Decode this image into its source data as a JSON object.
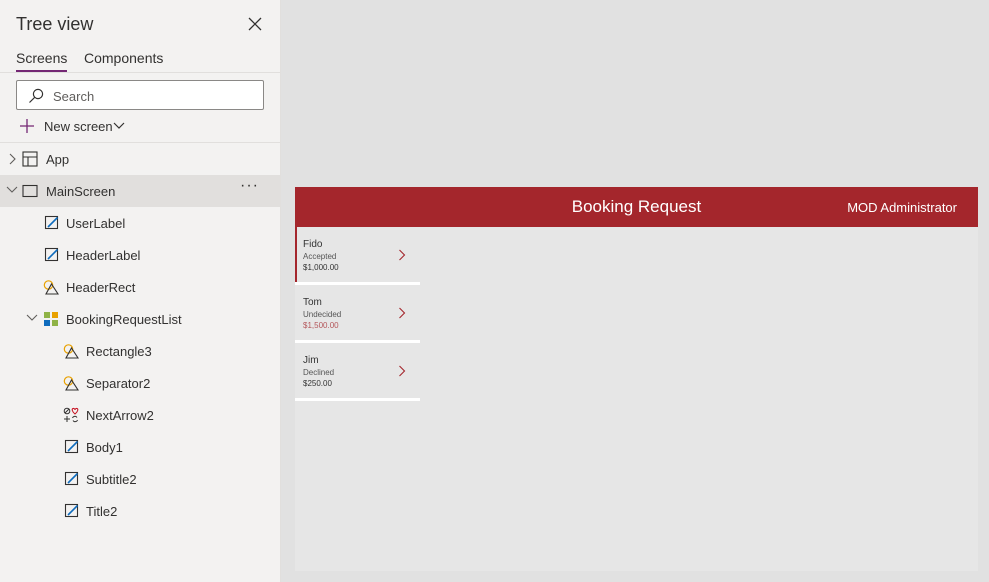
{
  "tree_panel": {
    "title": "Tree view",
    "tabs": [
      {
        "label": "Screens",
        "active": true
      },
      {
        "label": "Components",
        "active": false
      }
    ],
    "search": {
      "placeholder": "Search",
      "value": ""
    },
    "new_screen_label": "New screen",
    "items": [
      {
        "label": "App",
        "icon": "app-icon",
        "level": 0,
        "expander": "collapsed"
      },
      {
        "label": "MainScreen",
        "icon": "screen-icon",
        "level": 0,
        "expander": "expanded",
        "selected": true
      },
      {
        "label": "UserLabel",
        "icon": "label-icon",
        "level": 1
      },
      {
        "label": "HeaderLabel",
        "icon": "label-icon",
        "level": 1
      },
      {
        "label": "HeaderRect",
        "icon": "shape-icon",
        "level": 1
      },
      {
        "label": "BookingRequestList",
        "icon": "gallery-icon",
        "level": 1,
        "expander": "expanded"
      },
      {
        "label": "Rectangle3",
        "icon": "shape-icon",
        "level": 2
      },
      {
        "label": "Separator2",
        "icon": "shape-icon",
        "level": 2
      },
      {
        "label": "NextArrow2",
        "icon": "icon-control-icon",
        "level": 2
      },
      {
        "label": "Body1",
        "icon": "label-icon",
        "level": 2
      },
      {
        "label": "Subtitle2",
        "icon": "label-icon",
        "level": 2
      },
      {
        "label": "Title2",
        "icon": "label-icon",
        "level": 2
      }
    ]
  },
  "app_screen": {
    "header_title": "Booking Request",
    "user_name": "MOD Administrator",
    "header_color": "#a4262c",
    "bookings": [
      {
        "name": "Fido",
        "status": "Accepted",
        "amount": "$1,000.00",
        "selected": true
      },
      {
        "name": "Tom",
        "status": "Undecided",
        "amount": "$1,500.00"
      },
      {
        "name": "Jim",
        "status": "Declined",
        "amount": "$250.00"
      }
    ]
  }
}
